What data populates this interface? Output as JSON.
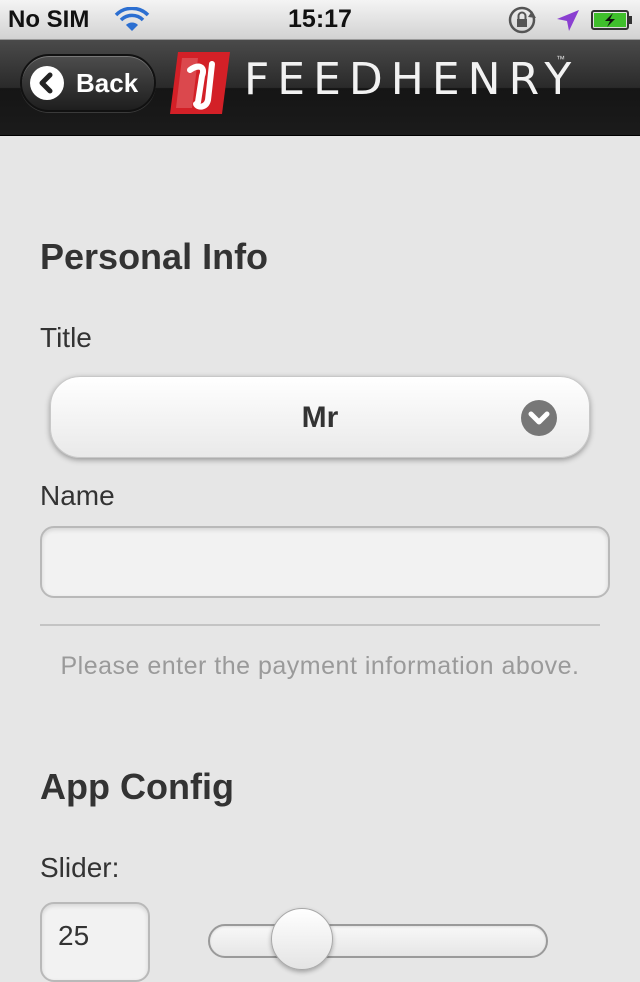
{
  "status_bar": {
    "carrier": "No SIM",
    "time": "15:17",
    "icons": [
      "wifi-icon",
      "rotation-lock-icon",
      "location-arrow-icon",
      "battery-charging-icon"
    ]
  },
  "header": {
    "back_label": "Back",
    "logo_text": "FEEDHENRY",
    "logo_tm": "™",
    "brand_color": "#d32027"
  },
  "personal_info": {
    "title": "Personal Info",
    "title_field": {
      "label": "Title",
      "selected": "Mr"
    },
    "name_field": {
      "label": "Name",
      "value": "",
      "placeholder": ""
    },
    "hint": "Please enter the payment information above."
  },
  "app_config": {
    "title": "App Config",
    "slider": {
      "label": "Slider:",
      "value": "25",
      "min": 0,
      "max": 100
    }
  }
}
